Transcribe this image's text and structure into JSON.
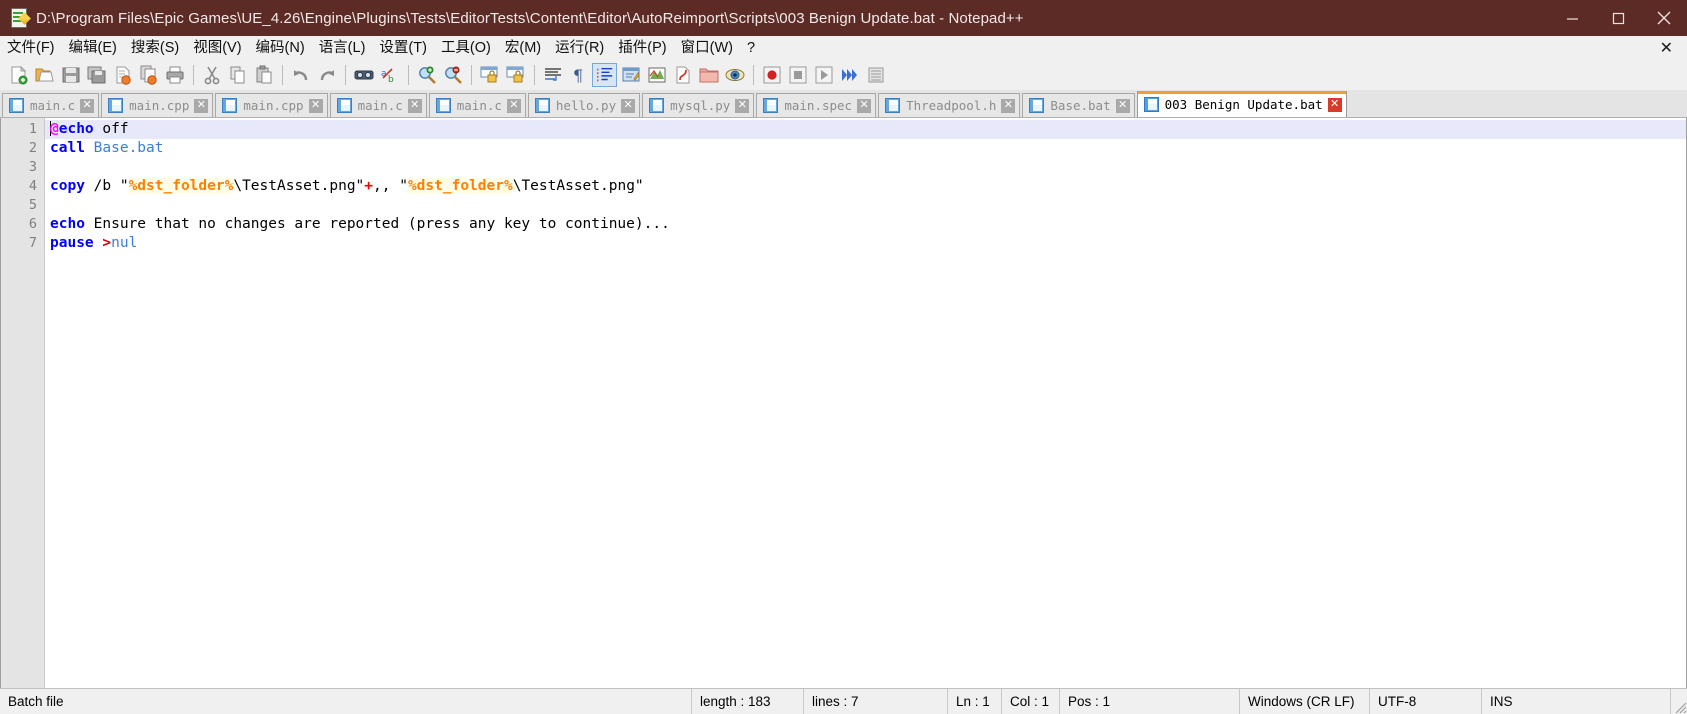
{
  "window": {
    "title": "D:\\Program Files\\Epic Games\\UE_4.26\\Engine\\Plugins\\Tests\\EditorTests\\Content\\Editor\\AutoReimport\\Scripts\\003 Benign Update.bat - Notepad++",
    "app_icon": "notepad-plus-plus-icon",
    "minimize_label": "─",
    "maximize_label": "□",
    "close_label": "✕",
    "titlebar_color": "#5c2b26"
  },
  "menubar": {
    "items": [
      {
        "label": "文件(F)"
      },
      {
        "label": "编辑(E)"
      },
      {
        "label": "搜索(S)"
      },
      {
        "label": "视图(V)"
      },
      {
        "label": "编码(N)"
      },
      {
        "label": "语言(L)"
      },
      {
        "label": "设置(T)"
      },
      {
        "label": "工具(O)"
      },
      {
        "label": "宏(M)"
      },
      {
        "label": "运行(R)"
      },
      {
        "label": "插件(P)"
      },
      {
        "label": "窗口(W)"
      },
      {
        "label": "?"
      }
    ],
    "close_document_label": "✕"
  },
  "toolbar": {
    "buttons": [
      {
        "name": "new-file-icon",
        "group": 0
      },
      {
        "name": "open-file-icon",
        "group": 0
      },
      {
        "name": "save-icon",
        "group": 0
      },
      {
        "name": "save-all-icon",
        "group": 0
      },
      {
        "name": "close-file-icon",
        "group": 0
      },
      {
        "name": "close-all-files-icon",
        "group": 0
      },
      {
        "name": "print-icon",
        "group": 0
      },
      {
        "name": "cut-icon",
        "group": 1
      },
      {
        "name": "copy-icon",
        "group": 1
      },
      {
        "name": "paste-icon",
        "group": 1
      },
      {
        "name": "undo-icon",
        "group": 2
      },
      {
        "name": "redo-icon",
        "group": 2
      },
      {
        "name": "find-icon",
        "group": 3
      },
      {
        "name": "replace-icon",
        "group": 3
      },
      {
        "name": "zoom-in-icon",
        "group": 4
      },
      {
        "name": "zoom-out-icon",
        "group": 4
      },
      {
        "name": "sync-vertical-scroll-icon",
        "group": 5
      },
      {
        "name": "sync-horizontal-scroll-icon",
        "group": 5
      },
      {
        "name": "word-wrap-icon",
        "group": 6
      },
      {
        "name": "show-all-characters-icon",
        "group": 6
      },
      {
        "name": "indent-guide-icon",
        "group": 6,
        "active": true
      },
      {
        "name": "user-defined-dialog-icon",
        "group": 6
      },
      {
        "name": "document-map-icon",
        "group": 6
      },
      {
        "name": "function-list-icon",
        "group": 6
      },
      {
        "name": "folder-as-workspace-icon",
        "group": 6
      },
      {
        "name": "monitoring-icon",
        "group": 6
      },
      {
        "name": "record-macro-icon",
        "group": 7
      },
      {
        "name": "stop-macro-icon",
        "group": 7
      },
      {
        "name": "play-macro-icon",
        "group": 7
      },
      {
        "name": "play-macro-multiple-icon",
        "group": 7
      },
      {
        "name": "save-macro-icon",
        "group": 7
      }
    ]
  },
  "tabs": [
    {
      "label": "main.c",
      "icon": "saved-file-icon",
      "active": false,
      "close": "✕"
    },
    {
      "label": "main.cpp",
      "icon": "saved-file-icon",
      "active": false,
      "close": "✕"
    },
    {
      "label": "main.cpp",
      "icon": "saved-file-icon",
      "active": false,
      "close": "✕"
    },
    {
      "label": "main.c",
      "icon": "saved-file-icon",
      "active": false,
      "close": "✕"
    },
    {
      "label": "main.c",
      "icon": "saved-file-icon",
      "active": false,
      "close": "✕"
    },
    {
      "label": "hello.py",
      "icon": "saved-file-icon",
      "active": false,
      "close": "✕"
    },
    {
      "label": "mysql.py",
      "icon": "saved-file-icon",
      "active": false,
      "close": "✕"
    },
    {
      "label": "main.spec",
      "icon": "saved-file-icon",
      "active": false,
      "close": "✕"
    },
    {
      "label": "Threadpool.h",
      "icon": "saved-file-icon",
      "active": false,
      "close": "✕"
    },
    {
      "label": "Base.bat",
      "icon": "saved-file-icon",
      "active": false,
      "close": "✕"
    },
    {
      "label": "003 Benign Update.bat",
      "icon": "saved-file-icon",
      "active": true,
      "close": "✕"
    }
  ],
  "editor": {
    "line_numbers": [
      "1",
      "2",
      "3",
      "4",
      "5",
      "6",
      "7"
    ],
    "lines": [
      {
        "n": 1,
        "current": true,
        "tokens": [
          {
            "t": "@",
            "c": "at"
          },
          {
            "t": "echo",
            "c": "kw"
          },
          {
            "t": " off",
            "c": "plain"
          }
        ]
      },
      {
        "n": 2,
        "current": false,
        "tokens": [
          {
            "t": "call",
            "c": "kw"
          },
          {
            "t": " ",
            "c": "plain"
          },
          {
            "t": "Base.bat",
            "c": "blue"
          }
        ]
      },
      {
        "n": 3,
        "current": false,
        "tokens": []
      },
      {
        "n": 4,
        "current": false,
        "tokens": [
          {
            "t": "copy",
            "c": "kw"
          },
          {
            "t": " /b \"",
            "c": "plain"
          },
          {
            "t": "%dst_folder%",
            "c": "var"
          },
          {
            "t": "\\TestAsset.png\"",
            "c": "plain"
          },
          {
            "t": "+",
            "c": "plus"
          },
          {
            "t": ",, \"",
            "c": "plain"
          },
          {
            "t": "%dst_folder%",
            "c": "var"
          },
          {
            "t": "\\TestAsset.png\"",
            "c": "plain"
          }
        ]
      },
      {
        "n": 5,
        "current": false,
        "tokens": []
      },
      {
        "n": 6,
        "current": false,
        "tokens": [
          {
            "t": "echo",
            "c": "kw"
          },
          {
            "t": " Ensure that no changes are reported (press any key to continue)...",
            "c": "plain"
          }
        ]
      },
      {
        "n": 7,
        "current": false,
        "tokens": [
          {
            "t": "pause",
            "c": "kw"
          },
          {
            "t": " ",
            "c": "plain"
          },
          {
            "t": ">",
            "c": "red"
          },
          {
            "t": "nul",
            "c": "blue"
          }
        ]
      }
    ]
  },
  "statusbar": {
    "doc_type": "Batch file",
    "length": "length : 183",
    "lines": "lines : 7",
    "ln": "Ln : 1",
    "col": "Col : 1",
    "pos": "Pos : 1",
    "eol": "Windows (CR LF)",
    "encoding": "UTF-8",
    "insert_mode": "INS"
  }
}
